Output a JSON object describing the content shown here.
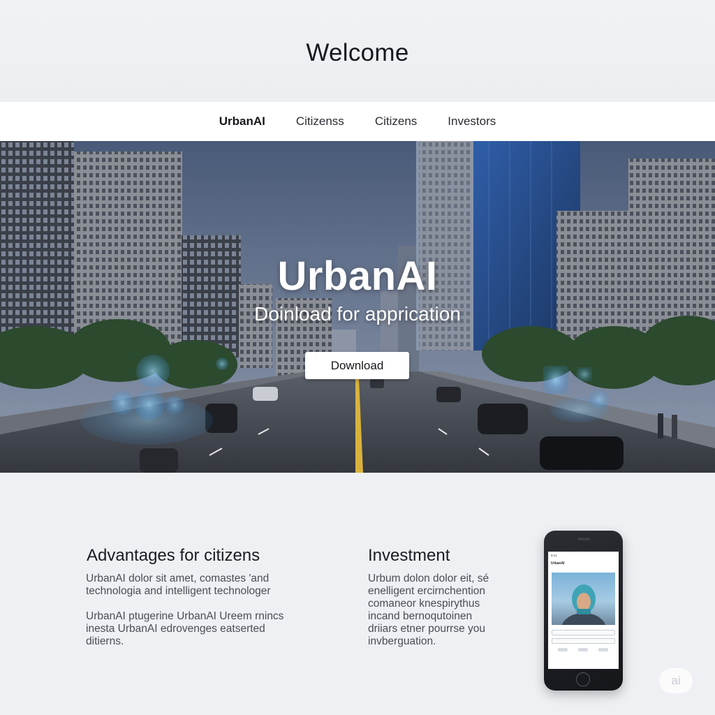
{
  "header": {
    "title": "Welcome"
  },
  "nav": {
    "items": [
      {
        "label": "UrbanAI"
      },
      {
        "label": "Citizenss"
      },
      {
        "label": "Citizens"
      },
      {
        "label": "Investors"
      }
    ]
  },
  "hero": {
    "title": "UrbanAI",
    "subtitle": "Doinload for apprication",
    "button_label": "Download"
  },
  "citizens": {
    "title": "Advantages for citizens",
    "para1": [
      "UrbanAI dolor sit amet, comastes 'and",
      "technologia and intelligent technologer"
    ],
    "para2": [
      "UrbanAI ptugerine UrbanAI Ureem rnincs",
      "inesta UrbanAI edrovenges eatserted",
      "ditierns."
    ]
  },
  "investment": {
    "title": "Investment",
    "lines": [
      "Urbum dolon dolor eit, sé",
      "enelligent ercirnchention",
      "comaneor knespirythus",
      "incand bernoqutoinen",
      "driiars etner pourrse you",
      "invberguation."
    ]
  },
  "phone": {
    "brand": "UrbanAI",
    "status_left": "9:41"
  },
  "badge": {
    "label": "ai"
  },
  "colors": {
    "page_bg": "#eef0f4",
    "nav_bg": "#ffffff",
    "button_bg": "#ffffff",
    "holo_accent": "#6fc3ff"
  }
}
